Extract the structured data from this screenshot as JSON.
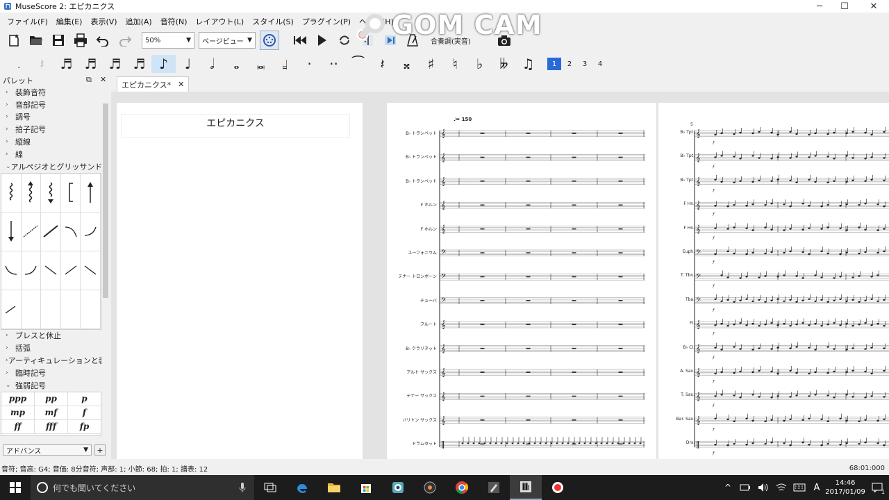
{
  "window": {
    "title": "MuseScore 2: エピカニクス"
  },
  "menu": [
    "ファイル(F)",
    "編集(E)",
    "表示(V)",
    "追加(A)",
    "音符(N)",
    "レイアウト(L)",
    "スタイル(S)",
    "プラグイン(P)",
    "ヘルプ(H)"
  ],
  "toolbar": {
    "zoom": "50%",
    "view_mode": "ページビュー",
    "concert_pitch": "合奏調(実音)"
  },
  "overlay": {
    "watermark": "GOM CAM"
  },
  "note_input": {
    "pages": [
      "1",
      "2",
      "3",
      "4"
    ],
    "selected_page": "1"
  },
  "palette": {
    "title": "パレット",
    "sections_top": [
      "装飾音符",
      "音部記号",
      "調号",
      "拍子記号",
      "縦線",
      "線",
      "アルペジオとグリッサンド"
    ],
    "sections_bottom": [
      "ブレスと休止",
      "括弧",
      "アーティキュレーションと装飾",
      "臨時記号",
      "強弱記号"
    ],
    "dynamics": [
      "ppp",
      "pp",
      "p",
      "mp",
      "mf",
      "f",
      "ff",
      "fff",
      "fp"
    ],
    "workspace": "アドバンス"
  },
  "score": {
    "tab": "エピカニクス*",
    "title": "エピカニクス",
    "tempo": "♩= 150",
    "instruments_long": [
      "B♭ トランペット",
      "B♭ トランペット",
      "B♭ トランペット",
      "F ホルン",
      "F ホルン",
      "ユーフォニウム",
      "テナー トロンボーン",
      "チューバ",
      "フルート",
      "B♭ クラリネット",
      "アルト サックス",
      "テナー サックス",
      "バリトン サックス",
      "ドラムセット"
    ],
    "instruments_short": [
      "B♭ Tpt.",
      "B♭ Tpt.",
      "B♭ Tpt.",
      "F Hn.",
      "F Hn.",
      "Euph.",
      "T. Tbn.",
      "Tba.",
      "Fl.",
      "B♭ Cl.",
      "A. Sax.",
      "T. Sax.",
      "Bar. Sax.",
      "Drs."
    ],
    "page3_measure_number": "5"
  },
  "status": {
    "left": "音符; 音高: G4; 音価: 8分音符; 声部: 1; 小節: 68; 拍: 1; 譜表: 12",
    "right": "68:01:000"
  },
  "taskbar": {
    "search_placeholder": "何でも聞いてください",
    "time": "14:46",
    "date": "2017/01/09",
    "ime": "A",
    "notification_count": "1"
  },
  "colors": {
    "accent": "#2a6ad8",
    "taskbar": "#1c1c1c"
  }
}
